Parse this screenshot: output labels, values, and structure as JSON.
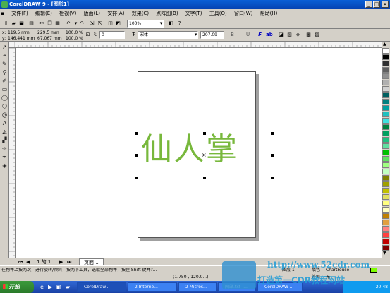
{
  "window": {
    "title": "CorelDRAW 9 - [图形1]",
    "controls": [
      "_",
      "□",
      "×"
    ]
  },
  "menubar": {
    "items": [
      "文件(F)",
      "编辑(E)",
      "检视(V)",
      "版面(L)",
      "安排(A)",
      "效果(C)",
      "点阵图(B)",
      "文字(T)",
      "工具(O)",
      "窗口(W)",
      "帮助(H)"
    ]
  },
  "toolbar": {
    "zoom_value": "100%"
  },
  "propbar": {
    "x_label": "x:",
    "x_value": "119.5 mm",
    "y_label": "y:",
    "y_value": "146.441 mm",
    "w_value": "229.5 mm",
    "h_value": "67.067 mm",
    "scale_w": "100.0",
    "scale_h": "100.0",
    "pct": "%",
    "rotation": "0",
    "font_name": "宋体",
    "font_size": "207.09",
    "bold": "B",
    "italic": "I",
    "underline": "U",
    "format": "F",
    "ab": "ab"
  },
  "canvas": {
    "text": "仙人掌",
    "text_color": "#78b83c"
  },
  "pagenav": {
    "counter": "1 的 1",
    "page_tab": "页面 1"
  },
  "status": {
    "left_text": "在物件上按两次，进行旋转/倾斜；按两下工具，选取全部物件；按住 Shift 键并?...",
    "coords": "(1.750 , 120.0...)",
    "layer": "图层 1",
    "fill_label": "填色",
    "fill_value": "Chartreuse",
    "outline_label": "外框",
    "outline_value": "无"
  },
  "taskbar": {
    "start": "开始",
    "tasks": [
      "CorelDraw...",
      "2 Interne...",
      "2 Micros...",
      "网站.txt -...",
      "CorelDRAW ..."
    ],
    "time": "20:48"
  },
  "watermark": {
    "url": "http://www.52cdr.com",
    "cn": "打造第一CDR教程网站"
  },
  "palette_colors": [
    "#ffffff",
    "#000000",
    "#303030",
    "#606060",
    "#909090",
    "#b0b0b0",
    "#d0d0d0",
    "#006060",
    "#008080",
    "#00a0a0",
    "#20c0c0",
    "#40e0e0",
    "#008040",
    "#00a060",
    "#20c080",
    "#60e0a0",
    "#00c000",
    "#60e060",
    "#a0ff80",
    "#c0ffc0",
    "#808000",
    "#a0a000",
    "#c0c000",
    "#e0e060",
    "#ffff80",
    "#ffffc0",
    "#c08000",
    "#e0a040",
    "#ff8080",
    "#ff4040",
    "#c00000",
    "#800000"
  ]
}
